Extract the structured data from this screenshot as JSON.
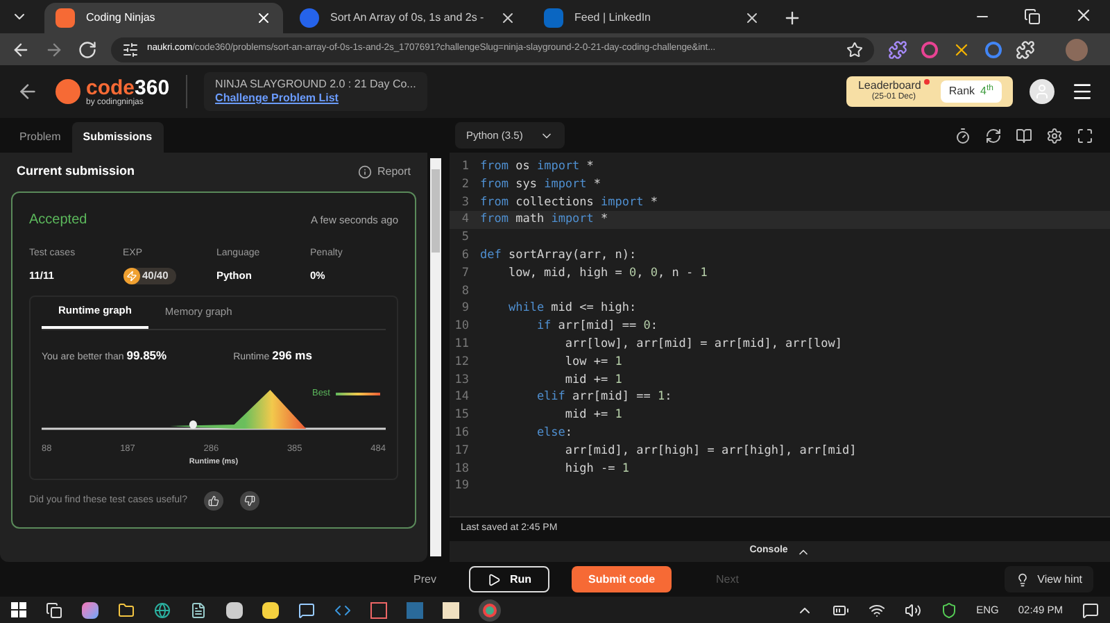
{
  "browser": {
    "tabs": [
      {
        "title": "Coding Ninjas",
        "selected": true,
        "kind": "cn"
      },
      {
        "title": "Sort An Array of 0s, 1s and 2s -",
        "selected": false,
        "kind": "k"
      },
      {
        "title": "Feed | LinkedIn",
        "selected": false,
        "kind": "in"
      }
    ],
    "url": {
      "domain": "naukri.com",
      "path": "/code360/problems/sort-an-array-of-0s-1s-and-2s_1707691?challengeSlug=ninja-slayground-2-0-21-day-coding-challenge&int..."
    }
  },
  "header": {
    "logo_main": "code",
    "logo_num": "360",
    "logo_sub": "by codingninjas",
    "event_title": "NINJA SLAYGROUND 2.0 : 21 Day Co...",
    "challenge_link": "Challenge Problem List",
    "leaderboard": {
      "label": "Leaderboard",
      "dates": "(25-01 Dec)",
      "rank_label": "Rank",
      "rank_value": "4$^{th}$"
    }
  },
  "left": {
    "tabs": [
      {
        "label": "Problem",
        "selected": false
      },
      {
        "label": "Submissions",
        "selected": true
      }
    ],
    "title": "Current submission",
    "report": "Report",
    "result": {
      "status": "Accepted",
      "time": "A few seconds ago",
      "stats": [
        {
          "label": "Test cases",
          "value": "11/11",
          "kind": "text"
        },
        {
          "label": "EXP",
          "value": "40/40",
          "kind": "exp"
        },
        {
          "label": "Language",
          "value": "Python",
          "kind": "text"
        },
        {
          "label": "Penalty",
          "value": "0%",
          "kind": "text"
        }
      ],
      "graph_tabs": [
        {
          "label": "Runtime graph",
          "selected": true
        },
        {
          "label": "Memory graph",
          "selected": false
        }
      ],
      "better_label": "You are better than",
      "better_value": "99.85%",
      "runtime_label": "Runtime",
      "runtime_value": "296 ms",
      "legend": "Best",
      "xticks": [
        "88",
        "187",
        "286",
        "385",
        "484"
      ],
      "xlabel": "Runtime (ms)",
      "feedback": "Did you find these test cases useful?"
    }
  },
  "editor": {
    "language": "Python (3.5)",
    "lines": [
      {
        "number": "1",
        "current": false,
        "tokens": [
          {
            "kind": "kw",
            "text": "from"
          },
          {
            "kind": "plain",
            "text": " os "
          },
          {
            "kind": "kw",
            "text": "import"
          },
          {
            "kind": "plain",
            "text": " *"
          }
        ]
      },
      {
        "number": "2",
        "current": false,
        "tokens": [
          {
            "kind": "kw",
            "text": "from"
          },
          {
            "kind": "plain",
            "text": " sys "
          },
          {
            "kind": "kw",
            "text": "import"
          },
          {
            "kind": "plain",
            "text": " *"
          }
        ]
      },
      {
        "number": "3",
        "current": false,
        "tokens": [
          {
            "kind": "kw",
            "text": "from"
          },
          {
            "kind": "plain",
            "text": " collections "
          },
          {
            "kind": "kw",
            "text": "import"
          },
          {
            "kind": "plain",
            "text": " *"
          }
        ]
      },
      {
        "number": "4",
        "current": true,
        "tokens": [
          {
            "kind": "kw",
            "text": "from"
          },
          {
            "kind": "plain",
            "text": " math "
          },
          {
            "kind": "kw",
            "text": "import"
          },
          {
            "kind": "plain",
            "text": " *"
          }
        ]
      },
      {
        "number": "5",
        "current": false
      },
      {
        "number": "6",
        "current": false,
        "tokens": [
          {
            "kind": "kw",
            "text": "def"
          },
          {
            "kind": "plain",
            "text": " sortArray(arr, n):"
          }
        ]
      },
      {
        "number": "7",
        "current": false,
        "tokens": [
          {
            "kind": "plain",
            "text": "    low, mid, high = "
          },
          {
            "kind": "num",
            "text": "0"
          },
          {
            "kind": "plain",
            "text": ", "
          },
          {
            "kind": "num",
            "text": "0"
          },
          {
            "kind": "plain",
            "text": ", n - "
          },
          {
            "kind": "num",
            "text": "1"
          }
        ]
      },
      {
        "number": "8",
        "current": false
      },
      {
        "number": "9",
        "current": false,
        "tokens": [
          {
            "kind": "kw",
            "text": "    while"
          },
          {
            "kind": "plain",
            "text": " mid <= high:"
          }
        ]
      },
      {
        "number": "10",
        "current": false,
        "tokens": [
          {
            "kind": "kw",
            "text": "        if"
          },
          {
            "kind": "plain",
            "text": " arr[mid] == "
          },
          {
            "kind": "num",
            "text": "0"
          },
          {
            "kind": "plain",
            "text": ":"
          }
        ]
      },
      {
        "number": "11",
        "current": false,
        "tokens": [
          {
            "kind": "plain",
            "text": "            arr[low], arr[mid] = arr[mid], arr[low]"
          }
        ]
      },
      {
        "number": "12",
        "current": false,
        "tokens": [
          {
            "kind": "plain",
            "text": "            low += "
          },
          {
            "kind": "num",
            "text": "1"
          }
        ]
      },
      {
        "number": "13",
        "current": false,
        "tokens": [
          {
            "kind": "plain",
            "text": "            mid += "
          },
          {
            "kind": "num",
            "text": "1"
          }
        ]
      },
      {
        "number": "14",
        "current": false,
        "tokens": [
          {
            "kind": "kw",
            "text": "        elif"
          },
          {
            "kind": "plain",
            "text": " arr[mid] == "
          },
          {
            "kind": "num",
            "text": "1"
          },
          {
            "kind": "plain",
            "text": ":"
          }
        ]
      },
      {
        "number": "15",
        "current": false,
        "tokens": [
          {
            "kind": "plain",
            "text": "            mid += "
          },
          {
            "kind": "num",
            "text": "1"
          }
        ]
      },
      {
        "number": "16",
        "current": false,
        "tokens": [
          {
            "kind": "kw",
            "text": "        else"
          },
          {
            "kind": "plain",
            "text": ":"
          }
        ]
      },
      {
        "number": "17",
        "current": false,
        "tokens": [
          {
            "kind": "plain",
            "text": "            arr[mid], arr[high] = arr[high], arr[mid]"
          }
        ]
      },
      {
        "number": "18",
        "current": false,
        "tokens": [
          {
            "kind": "plain",
            "text": "            high -= "
          },
          {
            "kind": "num",
            "text": "1"
          }
        ]
      },
      {
        "number": "19",
        "current": false
      }
    ],
    "last_saved": "Last saved at 2:45 PM",
    "console": "Console"
  },
  "footer": {
    "prev": {
      "label": "Prev",
      "disabled": false
    },
    "run": "Run",
    "submit": "Submit code",
    "next": {
      "label": "Next",
      "disabled": true
    },
    "hint": "View hint"
  },
  "taskbar": {
    "language": "ENG",
    "time": "02:49 PM"
  }
}
